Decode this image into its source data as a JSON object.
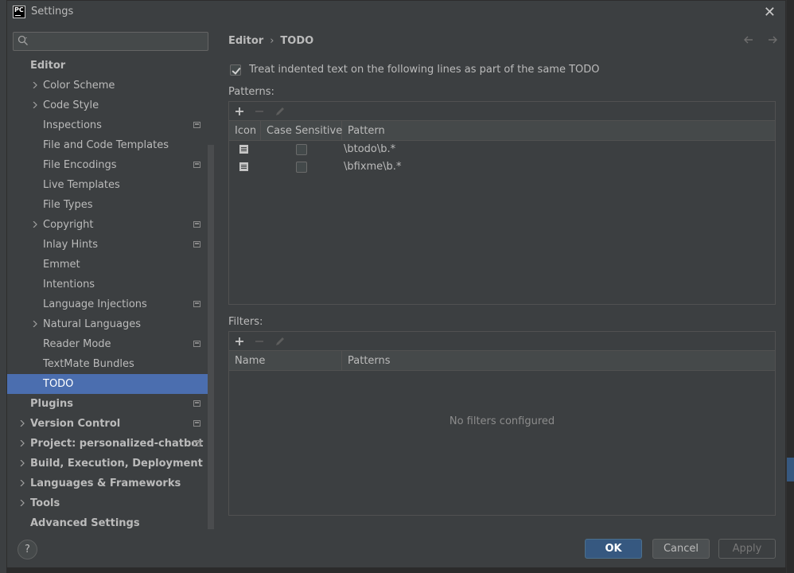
{
  "window": {
    "title": "Settings",
    "app_icon_text": "PC"
  },
  "search": {
    "placeholder": "",
    "value": ""
  },
  "sidebar": {
    "items": [
      {
        "label": "Editor",
        "bold": true,
        "level": 0,
        "expandable": false,
        "project": false,
        "selected": false
      },
      {
        "label": "Color Scheme",
        "bold": false,
        "level": 1,
        "expandable": true,
        "project": false,
        "selected": false
      },
      {
        "label": "Code Style",
        "bold": false,
        "level": 1,
        "expandable": true,
        "project": false,
        "selected": false
      },
      {
        "label": "Inspections",
        "bold": false,
        "level": 1,
        "expandable": false,
        "project": true,
        "selected": false
      },
      {
        "label": "File and Code Templates",
        "bold": false,
        "level": 1,
        "expandable": false,
        "project": false,
        "selected": false
      },
      {
        "label": "File Encodings",
        "bold": false,
        "level": 1,
        "expandable": false,
        "project": true,
        "selected": false
      },
      {
        "label": "Live Templates",
        "bold": false,
        "level": 1,
        "expandable": false,
        "project": false,
        "selected": false
      },
      {
        "label": "File Types",
        "bold": false,
        "level": 1,
        "expandable": false,
        "project": false,
        "selected": false
      },
      {
        "label": "Copyright",
        "bold": false,
        "level": 1,
        "expandable": true,
        "project": true,
        "selected": false
      },
      {
        "label": "Inlay Hints",
        "bold": false,
        "level": 1,
        "expandable": false,
        "project": true,
        "selected": false
      },
      {
        "label": "Emmet",
        "bold": false,
        "level": 1,
        "expandable": false,
        "project": false,
        "selected": false
      },
      {
        "label": "Intentions",
        "bold": false,
        "level": 1,
        "expandable": false,
        "project": false,
        "selected": false
      },
      {
        "label": "Language Injections",
        "bold": false,
        "level": 1,
        "expandable": false,
        "project": true,
        "selected": false
      },
      {
        "label": "Natural Languages",
        "bold": false,
        "level": 1,
        "expandable": true,
        "project": false,
        "selected": false
      },
      {
        "label": "Reader Mode",
        "bold": false,
        "level": 1,
        "expandable": false,
        "project": true,
        "selected": false
      },
      {
        "label": "TextMate Bundles",
        "bold": false,
        "level": 1,
        "expandable": false,
        "project": false,
        "selected": false
      },
      {
        "label": "TODO",
        "bold": false,
        "level": 1,
        "expandable": false,
        "project": false,
        "selected": true
      },
      {
        "label": "Plugins",
        "bold": true,
        "level": 0,
        "expandable": false,
        "project": true,
        "selected": false
      },
      {
        "label": "Version Control",
        "bold": true,
        "level": 0,
        "expandable": true,
        "project": true,
        "selected": false
      },
      {
        "label": "Project: personalized-chatbot",
        "bold": true,
        "level": 0,
        "expandable": true,
        "project": true,
        "selected": false
      },
      {
        "label": "Build, Execution, Deployment",
        "bold": true,
        "level": 0,
        "expandable": true,
        "project": false,
        "selected": false
      },
      {
        "label": "Languages & Frameworks",
        "bold": true,
        "level": 0,
        "expandable": true,
        "project": false,
        "selected": false
      },
      {
        "label": "Tools",
        "bold": true,
        "level": 0,
        "expandable": true,
        "project": false,
        "selected": false
      },
      {
        "label": "Advanced Settings",
        "bold": true,
        "level": 0,
        "expandable": false,
        "project": false,
        "selected": false
      }
    ]
  },
  "breadcrumb": {
    "parent": "Editor",
    "separator": "›",
    "current": "TODO"
  },
  "todo": {
    "treat_indented_label": "Treat indented text on the following lines as part of the same TODO",
    "treat_indented_checked": true,
    "patterns_label": "Patterns:",
    "patterns_columns": [
      "Icon",
      "Case Sensitive",
      "Pattern"
    ],
    "patterns_rows": [
      {
        "icon": "todo-item-icon",
        "case_sensitive": false,
        "pattern": "\\btodo\\b.*"
      },
      {
        "icon": "todo-item-icon",
        "case_sensitive": false,
        "pattern": "\\bfixme\\b.*"
      }
    ],
    "filters_label": "Filters:",
    "filters_columns": [
      "Name",
      "Patterns"
    ],
    "filters_empty": "No filters configured"
  },
  "footer": {
    "help": "?",
    "ok": "OK",
    "cancel": "Cancel",
    "apply": "Apply",
    "apply_enabled": false
  },
  "colors": {
    "background": "#3c3f41",
    "selection": "#4b6eaf",
    "primary_button": "#365880"
  }
}
